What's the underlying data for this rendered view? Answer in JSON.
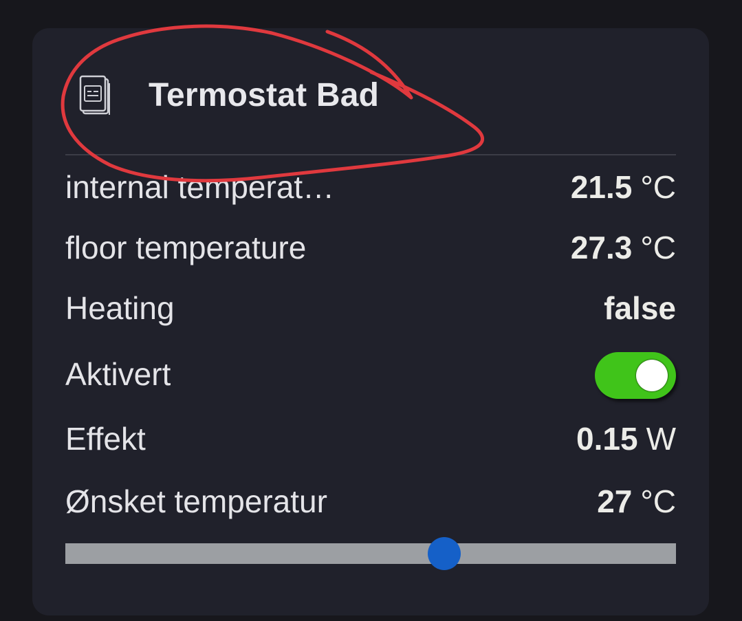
{
  "card": {
    "title": "Termostat Bad",
    "icon": "thermostat-device-icon"
  },
  "rows": [
    {
      "label": "internal temperat…",
      "value": "21.5",
      "unit": "°C"
    },
    {
      "label": "floor temperature",
      "value": "27.3",
      "unit": "°C"
    },
    {
      "label": "Heating",
      "value": "false"
    },
    {
      "label": "Aktivert",
      "toggle_on": true
    },
    {
      "label": "Effekt",
      "value": "0.15",
      "unit": "W"
    },
    {
      "label": "Ønsket temperatur",
      "value": "27",
      "unit": "°C"
    }
  ],
  "slider": {
    "value_fraction": 0.62
  },
  "colors": {
    "background": "#17171c",
    "card": "#20212b",
    "toggle_on": "#40c41a",
    "slider_track": "#9c9fa3",
    "slider_thumb": "#1560c8",
    "annotation_stroke": "#e0393e"
  }
}
